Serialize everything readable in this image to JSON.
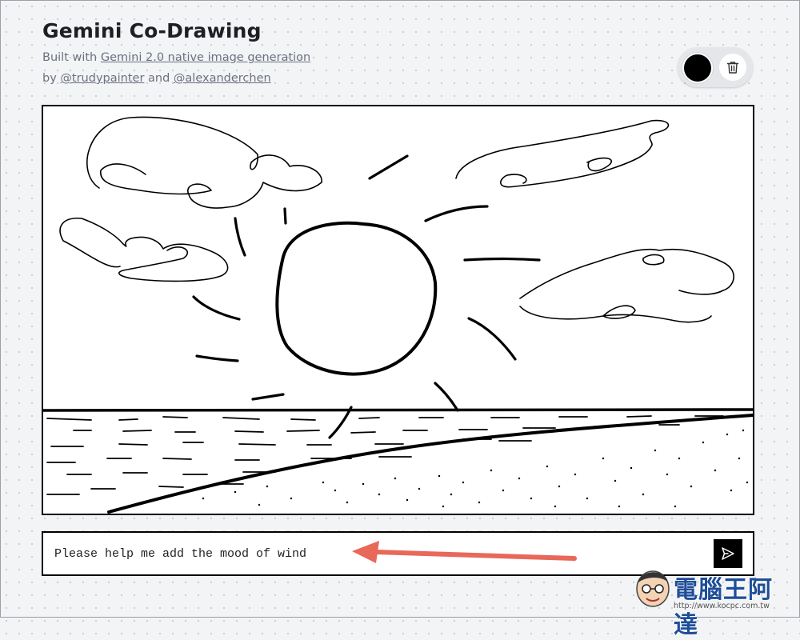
{
  "header": {
    "title": "Gemini Co-Drawing",
    "built_with_prefix": "Built with ",
    "built_with_link": "Gemini 2.0 native image generation",
    "by_prefix": "by ",
    "author1": "@trudypainter",
    "and_text": " and ",
    "author2": "@alexanderchen"
  },
  "toolbar": {
    "selected_color": "#000000",
    "color_icon": "color-swatch",
    "clear_icon": "trash-icon"
  },
  "canvas": {
    "content": "sketch-drawing"
  },
  "prompt": {
    "value": "Please help me add the mood of wind",
    "submit_icon": "send-icon"
  },
  "annotation": {
    "arrow_color": "#e8685a"
  },
  "watermark": {
    "brand": "電腦王阿達",
    "url": "http://www.kocpc.com.tw"
  }
}
